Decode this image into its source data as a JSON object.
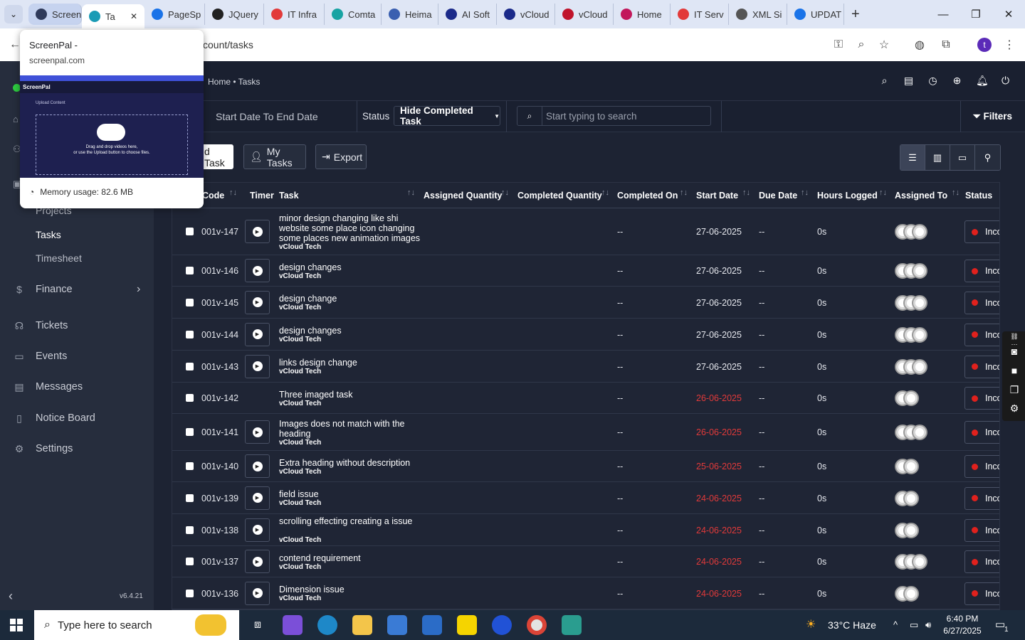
{
  "browser": {
    "tabs": [
      {
        "label": "Screen",
        "color": "#2f3a5a"
      },
      {
        "label": "Ta",
        "color": "#1a9bb5"
      },
      {
        "label": "PageSp",
        "color": "#1a73e8"
      },
      {
        "label": "JQuery",
        "color": "#222222"
      },
      {
        "label": "IT Infra",
        "color": "#e23a3a"
      },
      {
        "label": "Comta",
        "color": "#18a3a3"
      },
      {
        "label": "Heima",
        "color": "#3a5fb0"
      },
      {
        "label": "AI Soft",
        "color": "#1b2a8a"
      },
      {
        "label": "vCloud",
        "color": "#1b2a8a"
      },
      {
        "label": "vCloud",
        "color": "#c0142b"
      },
      {
        "label": "Home",
        "color": "#c2185b"
      },
      {
        "label": "IT Serv",
        "color": "#e23a3a"
      },
      {
        "label": "XML Si",
        "color": "#555555"
      },
      {
        "label": "UPDAT",
        "color": "#1a73e8"
      }
    ],
    "new_tab": "+",
    "url": "ccount/tasks",
    "profile_initial": "t"
  },
  "popup": {
    "title": "ScreenPal -",
    "url": "screenpal.com",
    "memory": "Memory usage: 82.6 MB",
    "thumb_brand": "ScreenPal",
    "thumb_upload": "Upload Content",
    "thumb_drop": "Drag and drop videos here,",
    "thumb_drop2": "or use the Upload button to choose files."
  },
  "app": {
    "breadcrumb": "Home • Tasks",
    "sidebar": {
      "sub_items": [
        "Projects",
        "Tasks",
        "Timesheet"
      ],
      "items": [
        {
          "label": "Finance",
          "icon": "dollar-icon"
        },
        {
          "label": "Tickets",
          "icon": "headset-icon"
        },
        {
          "label": "Events",
          "icon": "calendar-icon"
        },
        {
          "label": "Messages",
          "icon": "message-icon"
        },
        {
          "label": "Notice Board",
          "icon": "clipboard-icon"
        },
        {
          "label": "Settings",
          "icon": "gear-icon"
        }
      ],
      "version": "v6.4.21"
    },
    "filters": {
      "date_range": "Start Date To End Date",
      "status_label": "Status",
      "status_value": "Hide Completed Task",
      "search_placeholder": "Start typing to search",
      "filters_label": "Filters"
    },
    "actions": {
      "add_task": "d Task",
      "my_tasks": "My Tasks",
      "export": "Export"
    },
    "table": {
      "headers": [
        "Code",
        "Timer",
        "Task",
        "Assigned Quantity",
        "Completed Quantity",
        "Completed On",
        "Start Date",
        "Due Date",
        "Hours Logged",
        "Assigned To",
        "Status"
      ],
      "rows": [
        {
          "code": "001v-147",
          "task": "minor design changing like shi website some place icon changing some places new animation images",
          "project": "vCloud Tech",
          "completed_on": "--",
          "start": "27-06-2025",
          "due": "--",
          "hours": "0s",
          "avatars": 3,
          "status": "Inco",
          "overdue": false,
          "timer": true
        },
        {
          "code": "001v-146",
          "task": "design changes",
          "project": "vCloud Tech",
          "completed_on": "--",
          "start": "27-06-2025",
          "due": "--",
          "hours": "0s",
          "avatars": 3,
          "status": "Inco",
          "overdue": false,
          "timer": true
        },
        {
          "code": "001v-145",
          "task": "design change",
          "project": "vCloud Tech",
          "completed_on": "--",
          "start": "27-06-2025",
          "due": "--",
          "hours": "0s",
          "avatars": 3,
          "status": "Inco",
          "overdue": false,
          "timer": true
        },
        {
          "code": "001v-144",
          "task": "design changes",
          "project": "vCloud Tech",
          "completed_on": "--",
          "start": "27-06-2025",
          "due": "--",
          "hours": "0s",
          "avatars": 3,
          "status": "Inco",
          "overdue": false,
          "timer": true
        },
        {
          "code": "001v-143",
          "task": "links design change",
          "project": "vCloud Tech",
          "completed_on": "--",
          "start": "27-06-2025",
          "due": "--",
          "hours": "0s",
          "avatars": 3,
          "status": "Inco",
          "overdue": false,
          "timer": true
        },
        {
          "code": "001v-142",
          "task": "Three imaged task",
          "project": "vCloud Tech",
          "completed_on": "--",
          "start": "26-06-2025",
          "due": "--",
          "hours": "0s",
          "avatars": 2,
          "status": "Inco",
          "overdue": true,
          "timer": false
        },
        {
          "code": "001v-141",
          "task": "Images does not match with the heading",
          "project": "vCloud Tech",
          "completed_on": "--",
          "start": "26-06-2025",
          "due": "--",
          "hours": "0s",
          "avatars": 3,
          "status": "Inco",
          "overdue": true,
          "timer": true
        },
        {
          "code": "001v-140",
          "task": "Extra heading without description",
          "project": "vCloud Tech",
          "completed_on": "--",
          "start": "25-06-2025",
          "due": "--",
          "hours": "0s",
          "avatars": 2,
          "status": "Inco",
          "overdue": true,
          "timer": true
        },
        {
          "code": "001v-139",
          "task": "field issue",
          "project": "vCloud Tech",
          "completed_on": "--",
          "start": "24-06-2025",
          "due": "--",
          "hours": "0s",
          "avatars": 2,
          "status": "Inco",
          "overdue": true,
          "timer": true
        },
        {
          "code": "001v-138",
          "task": "scrolling effecting creating a issue",
          "project": "vCloud Tech",
          "completed_on": "--",
          "start": "24-06-2025",
          "due": "--",
          "hours": "0s",
          "avatars": 2,
          "status": "Inco",
          "overdue": true,
          "timer": true
        },
        {
          "code": "001v-137",
          "task": "contend requirement",
          "project": "vCloud Tech",
          "completed_on": "--",
          "start": "24-06-2025",
          "due": "--",
          "hours": "0s",
          "avatars": 3,
          "status": "Inco",
          "overdue": true,
          "timer": true
        },
        {
          "code": "001v-136",
          "task": "Dimension issue",
          "project": "vCloud Tech",
          "completed_on": "--",
          "start": "24-06-2025",
          "due": "--",
          "hours": "0s",
          "avatars": 2,
          "status": "Inco",
          "overdue": true,
          "timer": true
        }
      ]
    }
  },
  "taskbar": {
    "search_placeholder": "Type here to search",
    "weather": "33°C Haze",
    "time": "6:40 PM",
    "date": "6/27/2025",
    "notif_count": "1"
  },
  "colors": {
    "overdue": "#e23a3a",
    "status_dot": "#e0211d",
    "sidebar_bg": "#262d3d",
    "main_bg": "#1d2333"
  }
}
